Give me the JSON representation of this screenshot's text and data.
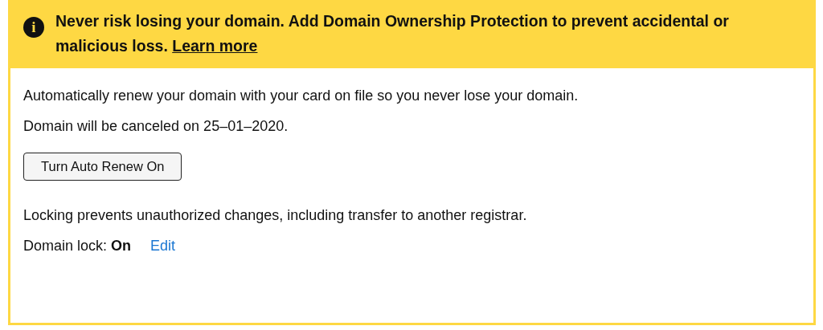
{
  "banner": {
    "icon": "i",
    "message": "Never risk losing your domain. Add Domain Ownership Protection to prevent accidental or malicious loss.",
    "link": "Learn more"
  },
  "auto_renew": {
    "description": "Automatically renew your domain with your card on file so you never lose your domain.",
    "status": "Domain will be canceled on 25–01–2020.",
    "button": "Turn Auto Renew On"
  },
  "lock": {
    "description": "Locking prevents unauthorized changes, including transfer to another registrar.",
    "status": "Domain lock: **On**",
    "edit": "Edit"
  }
}
